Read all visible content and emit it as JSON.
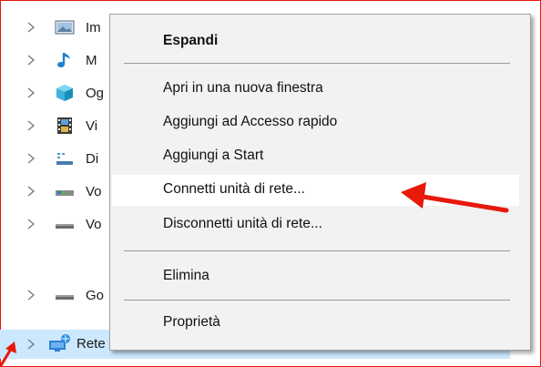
{
  "tree": {
    "items": [
      {
        "label": "Im",
        "icon": "pictures-icon"
      },
      {
        "label": "M",
        "icon": "music-icon"
      },
      {
        "label": "Og",
        "icon": "3d-objects-icon"
      },
      {
        "label": "Vi",
        "icon": "videos-icon"
      },
      {
        "label": "Di",
        "icon": "desktop-icon"
      },
      {
        "label": "Vo",
        "icon": "drive-icon"
      },
      {
        "label": "Vo",
        "icon": "drive-icon"
      },
      {
        "label": "Go",
        "icon": "drive-icon"
      }
    ],
    "selected": {
      "label": "Rete",
      "icon": "network-icon"
    }
  },
  "context_menu": {
    "expand": "Espandi",
    "open_new_window": "Apri in una nuova finestra",
    "add_quick_access": "Aggiungi ad Accesso rapido",
    "add_start": "Aggiungi a Start",
    "map_network_drive": "Connetti unità di rete...",
    "disconnect_network_drive": "Disconnetti unità di rete...",
    "delete": "Elimina",
    "properties": "Proprietà"
  },
  "colors": {
    "annotation": "#e8190b",
    "menu_bg": "#f2f2f2",
    "selection": "#cce8ff"
  }
}
